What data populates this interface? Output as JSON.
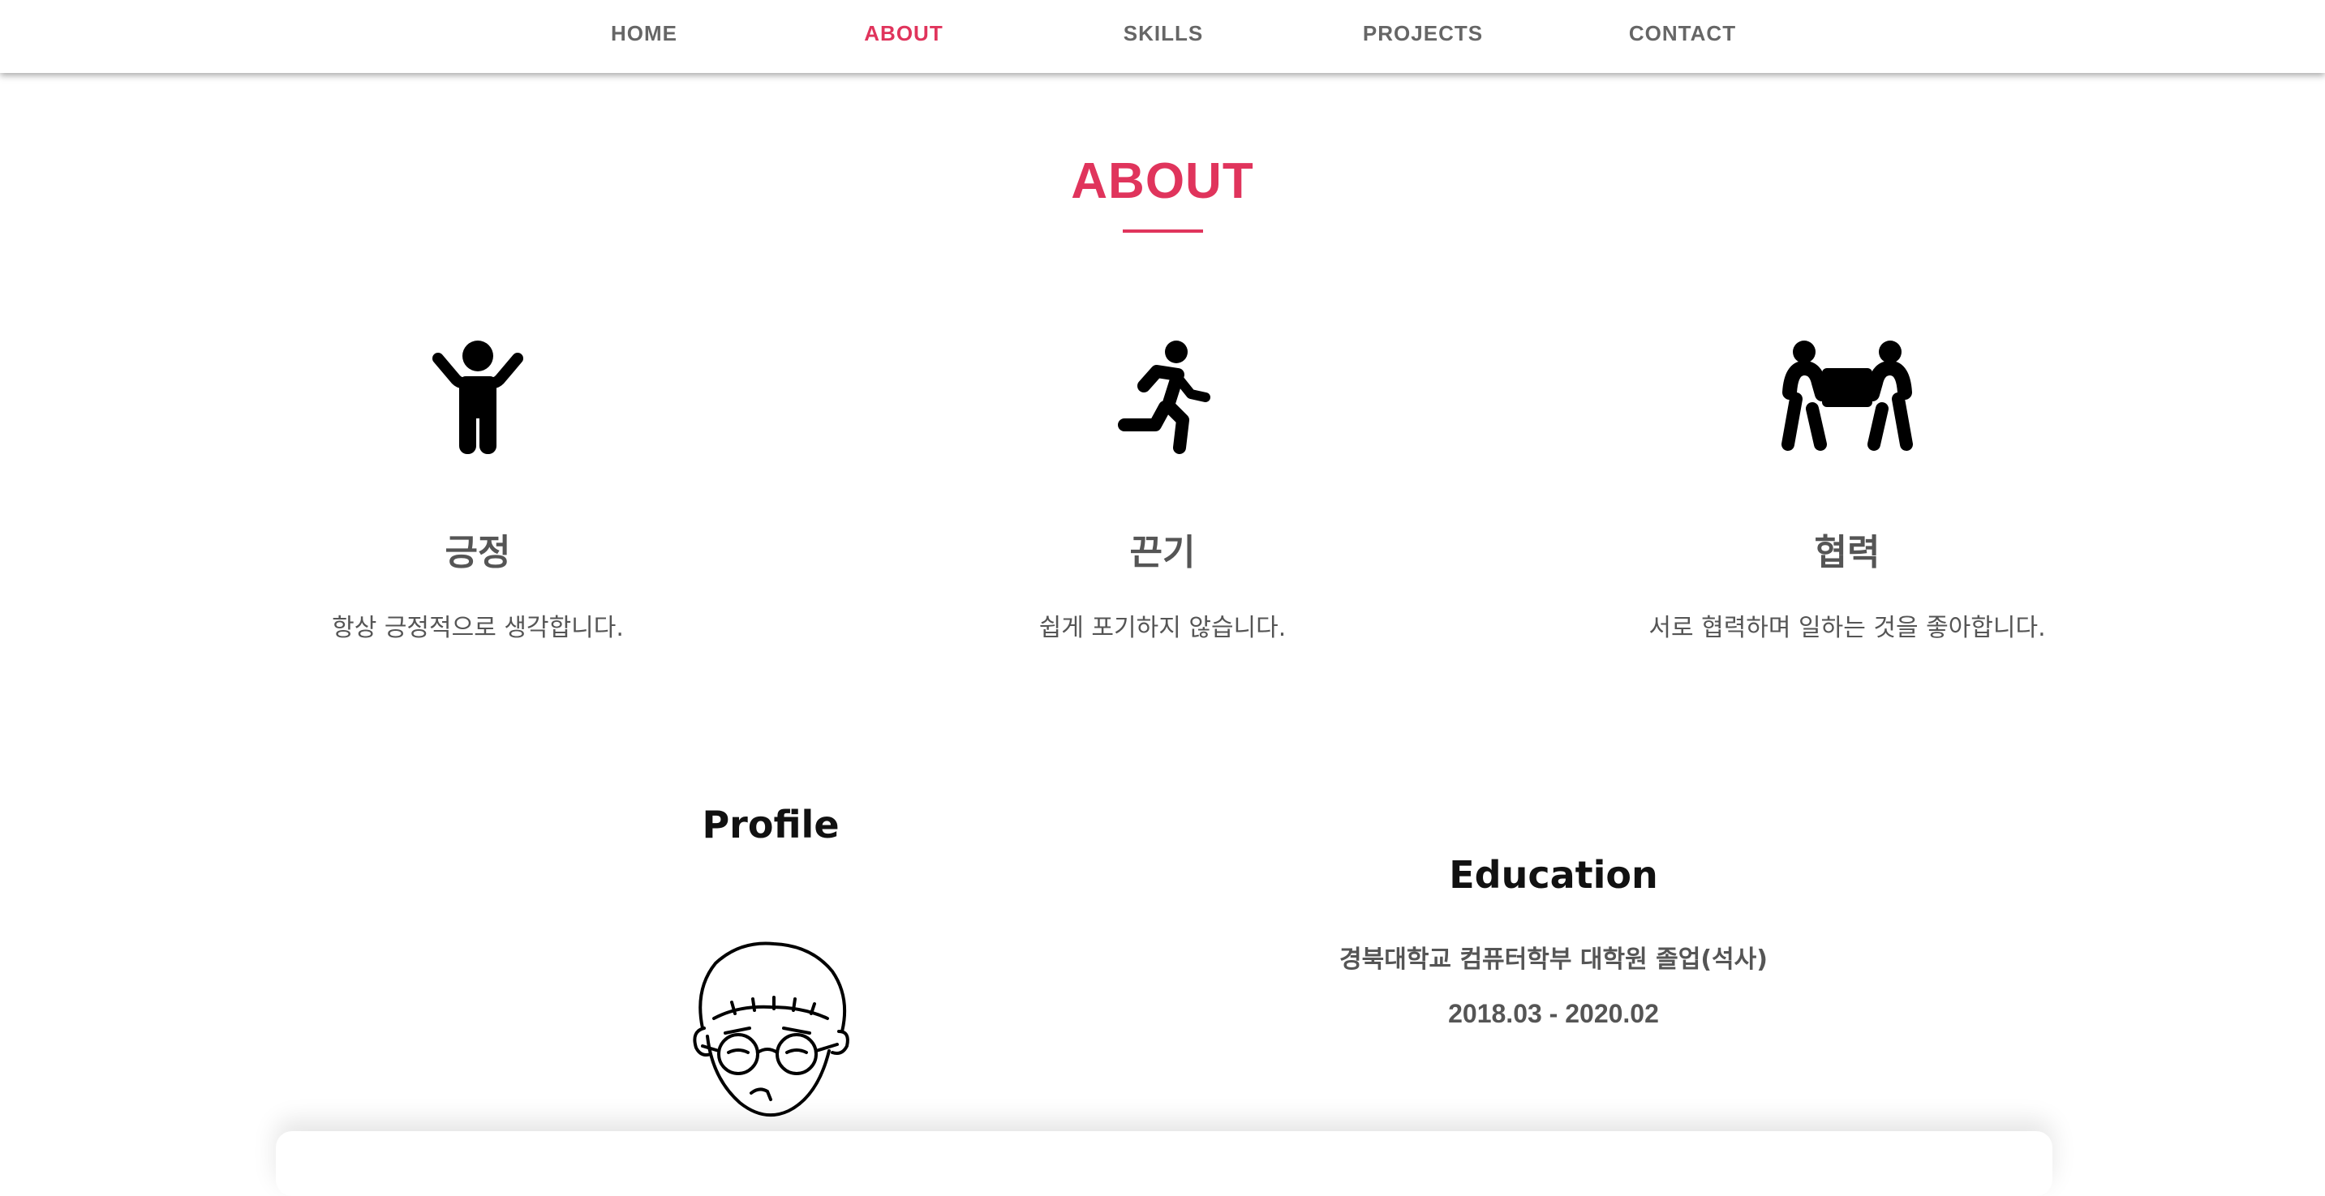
{
  "nav": {
    "items": [
      {
        "label": "HOME",
        "active": false
      },
      {
        "label": "ABOUT",
        "active": true
      },
      {
        "label": "SKILLS",
        "active": false
      },
      {
        "label": "PROJECTS",
        "active": false
      },
      {
        "label": "CONTACT",
        "active": false
      }
    ]
  },
  "about": {
    "title": "ABOUT",
    "accent_color": "#e0345c",
    "values": [
      {
        "icon": "child-arms-up-icon",
        "title": "긍정",
        "description": "항상 긍정적으로 생각합니다."
      },
      {
        "icon": "running-person-icon",
        "title": "끈기",
        "description": "쉽게 포기하지 않습니다."
      },
      {
        "icon": "people-carry-box-icon",
        "title": "협력",
        "description": "서로 협력하며 일하는 것을 좋아합니다."
      }
    ]
  },
  "profile": {
    "title": "Profile",
    "avatar_icon": "avatar-illustration"
  },
  "education": {
    "title": "Education",
    "school": "경북대학교 컴퓨터학부 대학원 졸업(석사)",
    "period": "2018.03 - 2020.02"
  }
}
